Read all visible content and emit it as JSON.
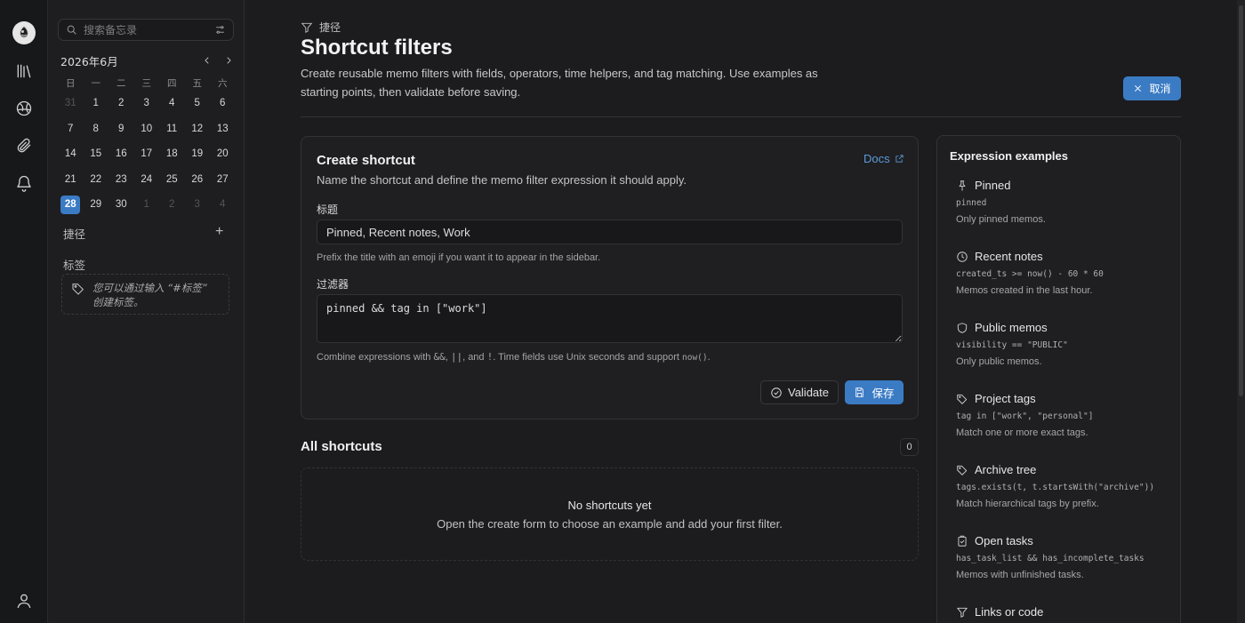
{
  "sidebar": {
    "search_placeholder": "搜索备忘录",
    "calendar": {
      "title": "2026年6月",
      "weekdays": [
        "日",
        "一",
        "二",
        "三",
        "四",
        "五",
        "六"
      ],
      "days": [
        {
          "d": "31",
          "dim": true
        },
        {
          "d": "1"
        },
        {
          "d": "2"
        },
        {
          "d": "3"
        },
        {
          "d": "4"
        },
        {
          "d": "5"
        },
        {
          "d": "6"
        },
        {
          "d": "7"
        },
        {
          "d": "8"
        },
        {
          "d": "9"
        },
        {
          "d": "10"
        },
        {
          "d": "11"
        },
        {
          "d": "12"
        },
        {
          "d": "13"
        },
        {
          "d": "14"
        },
        {
          "d": "15"
        },
        {
          "d": "16"
        },
        {
          "d": "17"
        },
        {
          "d": "18"
        },
        {
          "d": "19"
        },
        {
          "d": "20"
        },
        {
          "d": "21"
        },
        {
          "d": "22"
        },
        {
          "d": "23"
        },
        {
          "d": "24"
        },
        {
          "d": "25"
        },
        {
          "d": "26"
        },
        {
          "d": "27"
        },
        {
          "d": "28",
          "today": true
        },
        {
          "d": "29"
        },
        {
          "d": "30"
        },
        {
          "d": "1",
          "dim": true
        },
        {
          "d": "2",
          "dim": true
        },
        {
          "d": "3",
          "dim": true
        },
        {
          "d": "4",
          "dim": true
        }
      ]
    },
    "shortcuts_label": "捷径",
    "tags_label": "标签",
    "tags_hint": "您可以通过输入 “#标签” 创建标签。"
  },
  "header": {
    "crumb": "捷径",
    "title": "Shortcut filters",
    "description": "Create reusable memo filters with fields, operators, time helpers, and tag matching. Use examples as starting points, then validate before saving.",
    "cancel_label": "取消"
  },
  "create": {
    "title": "Create shortcut",
    "subtitle": "Name the shortcut and define the memo filter expression it should apply.",
    "docs_label": "Docs",
    "title_label": "标题",
    "title_value": "Pinned, Recent notes, Work",
    "title_help": "Prefix the title with an emoji if you want it to appear in the sidebar.",
    "filter_label": "过滤器",
    "filter_value": "pinned && tag in [\"work\"]",
    "filter_help_pre": "Combine expressions with ",
    "filter_help_and": "&&",
    "filter_help_sep1": ", ",
    "filter_help_or": "||",
    "filter_help_sep2": ", and ",
    "filter_help_not": "!",
    "filter_help_mid": ". Time fields use Unix seconds and support ",
    "filter_help_now": "now()",
    "filter_help_end": ".",
    "validate_label": "Validate",
    "save_label": "保存"
  },
  "all": {
    "title": "All shortcuts",
    "count": "0",
    "empty_title": "No shortcuts yet",
    "empty_desc": "Open the create form to choose an example and add your first filter."
  },
  "examples": {
    "title": "Expression examples",
    "items": [
      {
        "icon": "pin-icon",
        "name": "Pinned",
        "code": "pinned",
        "desc": "Only pinned memos."
      },
      {
        "icon": "clock-icon",
        "name": "Recent notes",
        "code": "created_ts >= now() - 60 * 60",
        "desc": "Memos created in the last hour."
      },
      {
        "icon": "shield-icon",
        "name": "Public memos",
        "code": "visibility == \"PUBLIC\"",
        "desc": "Only public memos."
      },
      {
        "icon": "tag-icon",
        "name": "Project tags",
        "code": "tag in [\"work\", \"personal\"]",
        "desc": "Match one or more exact tags."
      },
      {
        "icon": "tag-icon",
        "name": "Archive tree",
        "code": "tags.exists(t, t.startsWith(\"archive\"))",
        "desc": "Match hierarchical tags by prefix."
      },
      {
        "icon": "clipboard-check-icon",
        "name": "Open tasks",
        "code": "has_task_list && has_incomplete_tasks",
        "desc": "Memos with unfinished tasks."
      },
      {
        "icon": "filter-icon",
        "name": "Links or code",
        "code": "",
        "desc": ""
      }
    ]
  }
}
